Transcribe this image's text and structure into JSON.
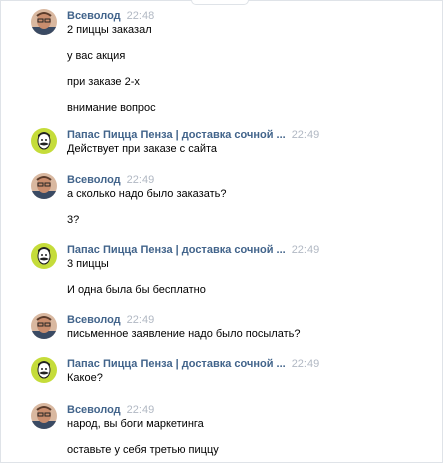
{
  "colors": {
    "author_link": "#42648b",
    "timestamp": "#b1b8c3",
    "text": "#000000",
    "frame_border": "#dfe3e8"
  },
  "messages": [
    {
      "author": "Всеволод",
      "time": "22:48",
      "avatar": "vsevolod-avatar",
      "lines": [
        "2 пиццы заказал",
        "у вас акция",
        "при заказе 2-х",
        "внимание вопрос"
      ]
    },
    {
      "author": "Папас Пицца Пенза | доставка сочной ...",
      "time": "22:49",
      "avatar": "papas-pizza-avatar",
      "lines": [
        "Действует при заказе с сайта"
      ]
    },
    {
      "author": "Всеволод",
      "time": "22:49",
      "avatar": "vsevolod-avatar",
      "lines": [
        "а сколько надо было заказать?",
        "3?"
      ]
    },
    {
      "author": "Папас Пицца Пенза | доставка сочной ...",
      "time": "22:49",
      "avatar": "papas-pizza-avatar",
      "lines": [
        "3 пиццы",
        "И одна была бы бесплатно"
      ]
    },
    {
      "author": "Всеволод",
      "time": "22:49",
      "avatar": "vsevolod-avatar",
      "lines": [
        "письменное заявление надо было посылать?"
      ]
    },
    {
      "author": "Папас Пицца Пенза | доставка сочной ...",
      "time": "22:49",
      "avatar": "papas-pizza-avatar",
      "lines": [
        "Какое?"
      ]
    },
    {
      "author": "Всеволод",
      "time": "22:49",
      "avatar": "vsevolod-avatar",
      "lines": [
        "народ, вы боги маркетинга",
        "оставьте у себя третью пиццу"
      ]
    }
  ]
}
